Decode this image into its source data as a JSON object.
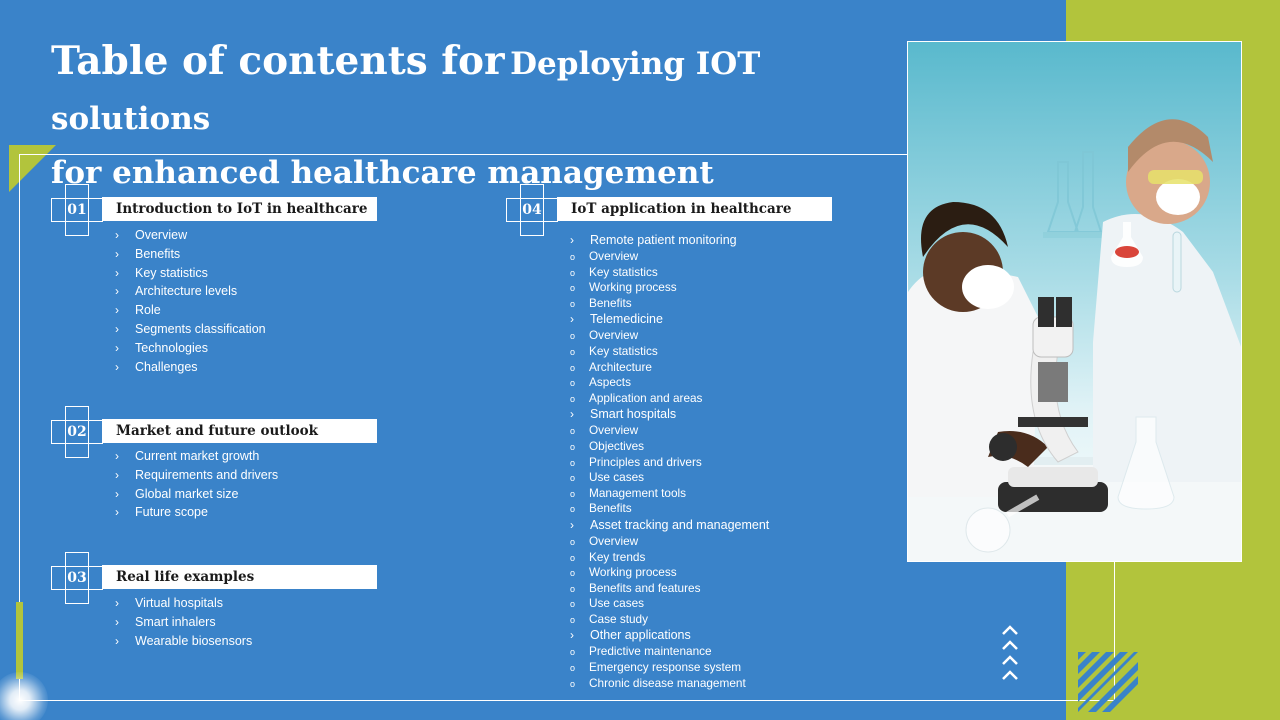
{
  "title": {
    "part1": "Table of contents for",
    "part2": "Deploying IOT solutions",
    "part3": "for enhanced healthcare management"
  },
  "sections": [
    {
      "number": "01",
      "heading": "Introduction  to IoT in healthcare",
      "items": [
        "Overview",
        "Benefits",
        "Key statistics",
        "Architecture levels",
        "Role",
        "Segments classification",
        "Technologies",
        "Challenges"
      ]
    },
    {
      "number": "02",
      "heading": "Market and future  outlook",
      "items": [
        "Current  market growth",
        "Requirements  and drivers",
        "Global market size",
        "Future scope"
      ]
    },
    {
      "number": "03",
      "heading": "Real life examples",
      "items": [
        "Virtual hospitals",
        "Smart inhalers",
        "Wearable biosensors"
      ]
    },
    {
      "number": "04",
      "heading": "IoT application  in healthcare",
      "groups": [
        {
          "label": "Remote patient monitoring",
          "items": [
            "Overview",
            "Key statistics",
            "Working process",
            "Benefits"
          ]
        },
        {
          "label": "Telemedicine",
          "items": [
            "Overview",
            "Key statistics",
            "Architecture",
            "Aspects",
            "Application and areas"
          ]
        },
        {
          "label": "Smart hospitals",
          "items": [
            "Overview",
            "Objectives",
            "Principles and drivers",
            "Use cases",
            "Management tools",
            "Benefits"
          ]
        },
        {
          "label": "Asset tracking and management",
          "items": [
            "Overview",
            "Key trends",
            "Working process",
            "Benefits and features",
            "Use cases",
            "Case study"
          ]
        },
        {
          "label": "Other applications",
          "items": [
            "Predictive maintenance",
            "Emergency response system",
            "Chronic disease management"
          ]
        }
      ]
    }
  ],
  "icons": {
    "bullet_main": "chevron-right-icon",
    "bullet_sub": "circle-outline-icon",
    "decor_chevrons": "chevron-up-stack-icon",
    "decor_stripes": "diagonal-stripes-icon"
  },
  "colors": {
    "background": "#3a83c9",
    "accent_green": "#b2c43c",
    "header_bar": "#ffffff",
    "header_text": "#1a1a1a"
  }
}
